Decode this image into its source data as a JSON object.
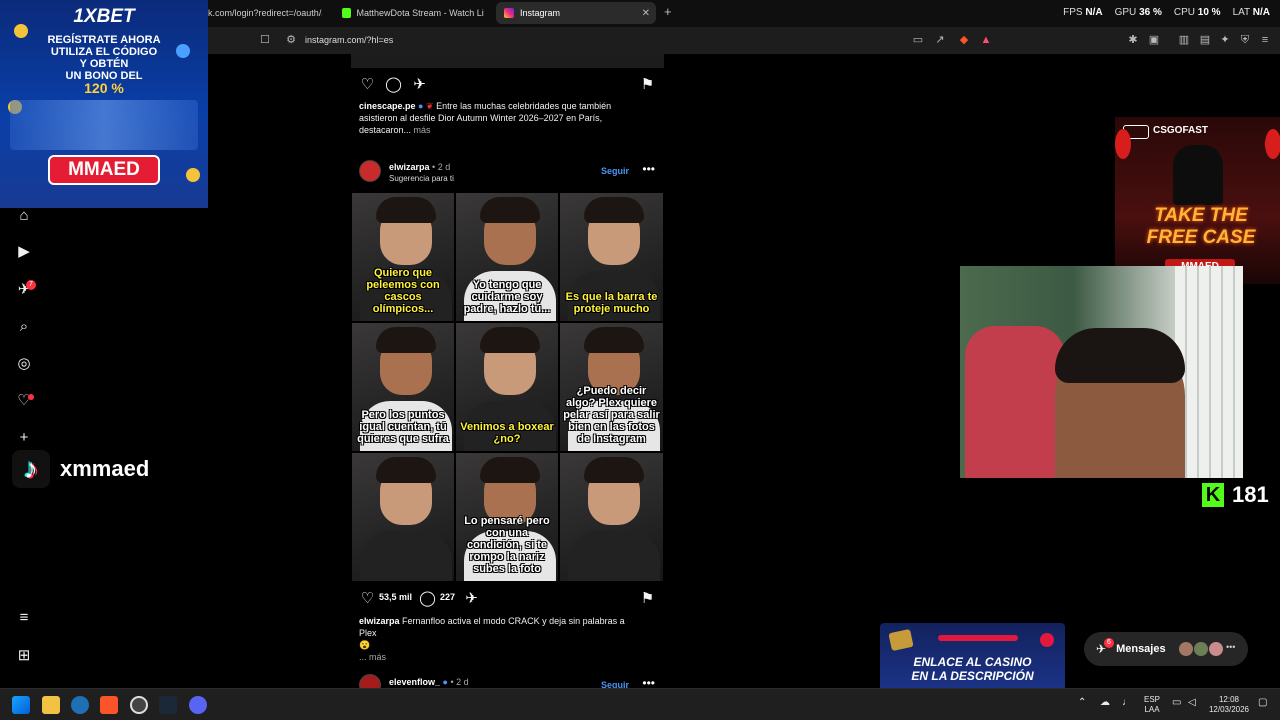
{
  "browser": {
    "tabs": [
      {
        "label": "k.com/login?redirect=/oauth/au"
      },
      {
        "label": "MatthewDota Stream - Watch Live on"
      },
      {
        "label": "Instagram"
      }
    ],
    "url": "instagram.com/?hl=es",
    "stats": {
      "fps_label": "FPS",
      "fps_value": "N/A",
      "gpu_label": "GPU",
      "gpu_value": "36 %",
      "cpu_label": "CPU",
      "cpu_value": "10 %",
      "lat_label": "LAT",
      "lat_value": "N/A"
    }
  },
  "nav": {
    "notifications_badge": "7"
  },
  "feed": {
    "post1": {
      "username": "cinescape.pe",
      "caption": "Entre las muchas celebridades que también asistieron al desfile Dior Autumn Winter 2026–2027 en París, destacaron...",
      "more": "más"
    },
    "post2": {
      "username": "elwizarpa",
      "time": "• 2 d",
      "subtitle": "Sugerencia para ti",
      "follow": "Seguir",
      "subs": [
        "Quiero que peleemos con cascos olímpicos...",
        "Yo tengo que cuidarme soy padre, hazlo tú...",
        "Es que la barra te proteje mucho",
        "Pero los puntos igual cuentan, tú quieres que sufra",
        "Venimos a boxear ¿no?",
        "¿Puedo decir algo? Plex quiere pelar así para salir bien en las fotos de Instagram",
        "",
        "Lo pensaré pero con una condición, si te rompo la nariz subes la foto",
        ""
      ],
      "likes": "53,5 mil",
      "comments": "227",
      "caption": "Fernanfloo activa el modo CRACK y deja sin palabras a Plex",
      "emoji": "😮",
      "more": "... más"
    },
    "post3": {
      "username": "elevenflow_",
      "time": "• 2 d",
      "follow": "Seguir"
    }
  },
  "overlays": {
    "bet": {
      "logo": "1XBET",
      "line1": "REGÍSTRATE AHORA",
      "line2": "UTILIZA EL CÓDIGO",
      "line3": "Y OBTÉN",
      "line4": "UN BONO DEL",
      "pct": "120 %",
      "code": "MMAED"
    },
    "tiktok": {
      "name": "xmmaed"
    },
    "csgo": {
      "brand": "CSGOFAST",
      "line1": "TAKE THE",
      "line2": "FREE CASE",
      "code": "MMAED"
    },
    "kick": {
      "count": "181"
    },
    "casino": {
      "line1": "ENLACE AL CASINO",
      "line2": "EN LA DESCRIPCIÓN"
    }
  },
  "messages": {
    "label": "Mensajes",
    "badge": "6"
  },
  "taskbar": {
    "lang1": "ESP",
    "lang2": "LAA",
    "time": "12:08",
    "date": "12/03/2026"
  }
}
